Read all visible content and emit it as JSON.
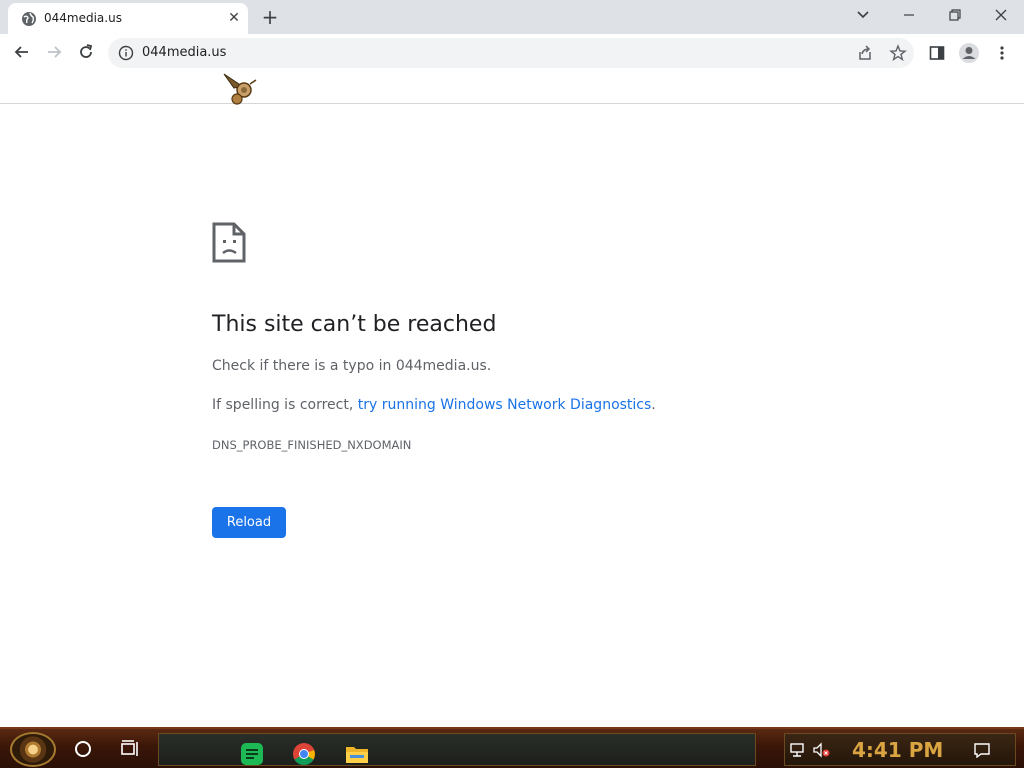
{
  "browser": {
    "tab": {
      "title": "044media.us"
    },
    "address": {
      "url": "044media.us"
    }
  },
  "error_page": {
    "heading": "This site can’t be reached",
    "typo_line": "Check if there is a typo in 044media.us.",
    "spelling_prefix": "If spelling is correct, ",
    "diagnostics_link": "try running Windows Network Diagnostics",
    "spelling_suffix": ".",
    "error_code": "DNS_PROBE_FINISHED_NXDOMAIN",
    "reload_label": "Reload"
  },
  "taskbar": {
    "clock": "4:41 PM",
    "pinned_apps": [
      "spotify-icon",
      "chrome-icon",
      "file-explorer-icon"
    ]
  },
  "colors": {
    "link": "#1a73e8",
    "button": "#1a73e8",
    "clock": "#d9a441"
  }
}
